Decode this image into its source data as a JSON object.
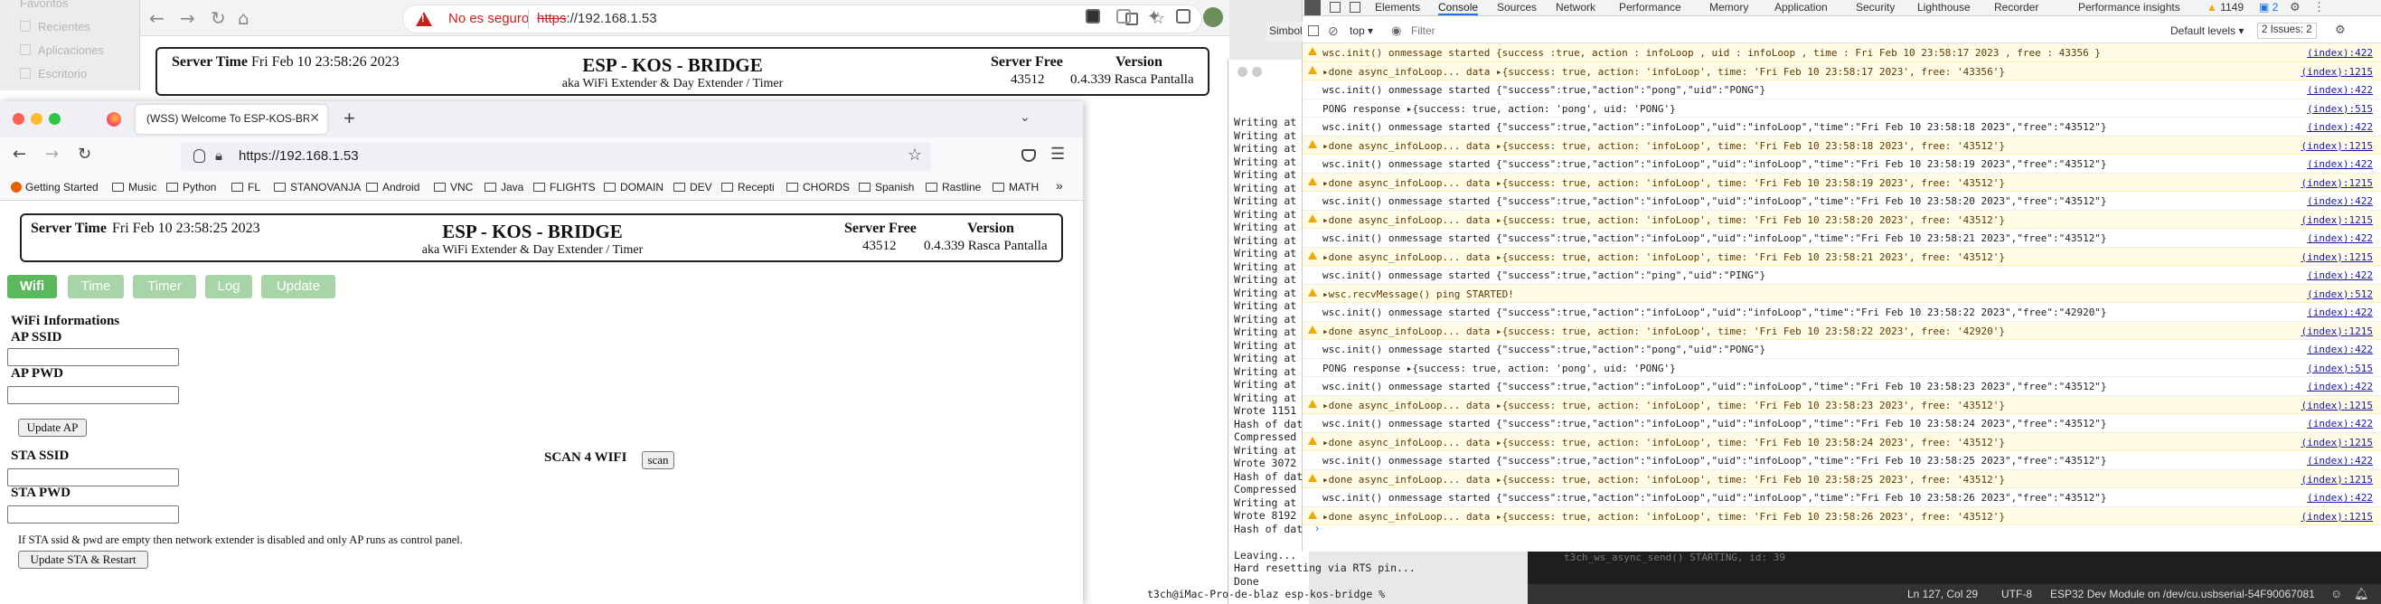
{
  "back_window": {
    "sidebar": [
      "Favoritos",
      "Recientes",
      "Aplicaciones",
      "Escritorio"
    ],
    "insecure_label": "No es seguro",
    "url_scheme": "https",
    "url_rest": "://192.168.1.53"
  },
  "esp_header": {
    "server_time_label": "Server Time",
    "title": "ESP - KOS - BRIDGE",
    "subtitle": "aka WiFi Extender & Day Extender / Timer",
    "server_free_label": "Server Free",
    "server_free_value": "43512",
    "version_label": "Version",
    "version_value": "0.4.339 Rasca Pantalla"
  },
  "back_window_time": "Fri Feb 10 23:58:26 2023",
  "firefox": {
    "tab_title": "(WSS) Welcome To ESP-KOS-BRIDG",
    "url": "https://192.168.1.53",
    "bookmarks": [
      "Getting Started",
      "Music",
      "Python",
      "FL",
      "STANOVANJA",
      "Android",
      "VNC",
      "Java",
      "FLIGHTS",
      "DOMAIN",
      "DEV",
      "Recepti",
      "CHORDS",
      "Spanish",
      "Rastline",
      "MATH"
    ],
    "server_time": "Fri Feb 10 23:58:25 2023",
    "nav_buttons": [
      "Wifi",
      "Time",
      "Timer",
      "Log",
      "Update"
    ],
    "wifi_info_heading": "WiFi Informations",
    "ap_ssid_label": "AP SSID",
    "ap_pwd_label": "AP PWD",
    "update_ap_button": "Update AP",
    "sta_ssid_label": "STA SSID",
    "scan_label": "SCAN 4 WIFI",
    "scan_button": "scan",
    "sta_pwd_label": "STA PWD",
    "note": "If STA ssid & pwd are empty then network extender is disabled and only AP runs as control panel.",
    "update_sta_button": "Update STA & Restart",
    "colors": {
      "active_tab": "#5cb85c",
      "inactive_tab": "#a8d5a8"
    }
  },
  "terminal": {
    "lines": [
      "Writing at",
      "Writing at",
      "Writing at",
      "Writing at",
      "Writing at",
      "Writing at",
      "Writing at",
      "Writing at",
      "Writing at",
      "Writing at",
      "Writing at",
      "Writing at",
      "Writing at",
      "Writing at",
      "Writing at",
      "Writing at",
      "Writing at",
      "Writing at",
      "Writing at",
      "Writing at",
      "Writing at",
      "Writing at",
      "Wrote 1151",
      "Hash of dat",
      "Compressed",
      "Writing at",
      "Wrote 3072",
      "Hash of dat",
      "Compressed",
      "Writing at",
      "Wrote 8192",
      "Hash of dat",
      "",
      "Leaving...",
      "Hard resetting via RTS pin...",
      "Done",
      "t3ch@iMac-Pro-de-blaz esp-kos-bridge % "
    ]
  },
  "devtools": {
    "tabs": [
      "Elements",
      "Console",
      "Sources",
      "Network",
      "Performance",
      "Memory",
      "Application",
      "Security",
      "Lighthouse",
      "Recorder",
      "Performance insights"
    ],
    "context": "top",
    "filter_placeholder": "Filter",
    "levels": "Default levels",
    "warn_count": "1149",
    "msg_count": "2",
    "issues": "2 Issues: 2",
    "side_label": "Simbol",
    "console": [
      {
        "t": "w",
        "m": "wsc.init() onmessage started {success :true, action : infoLoop , uid : infoLoop , time : Fri Feb 10 23:58:17 2023 , free : 43356 }",
        "s": "(index):422"
      },
      {
        "t": "w",
        "m": "▸done async_infoLoop... data ▸{success: true, action: 'infoLoop', time: 'Fri Feb 10 23:58:17 2023', free: '43356'}",
        "s": "(index):1215"
      },
      {
        "t": "n",
        "m": "wsc.init() onmessage started {\"success\":true,\"action\":\"pong\",\"uid\":\"PONG\"}",
        "s": "(index):422"
      },
      {
        "t": "n",
        "m": "PONG response ▸{success: true, action: 'pong', uid: 'PONG'}",
        "s": "(index):515"
      },
      {
        "t": "n",
        "m": "wsc.init() onmessage started {\"success\":true,\"action\":\"infoLoop\",\"uid\":\"infoLoop\",\"time\":\"Fri Feb 10 23:58:18 2023\",\"free\":\"43512\"}",
        "s": "(index):422"
      },
      {
        "t": "w",
        "m": "▸done async_infoLoop... data ▸{success: true, action: 'infoLoop', time: 'Fri Feb 10 23:58:18 2023', free: '43512'}",
        "s": "(index):1215"
      },
      {
        "t": "n",
        "m": "wsc.init() onmessage started {\"success\":true,\"action\":\"infoLoop\",\"uid\":\"infoLoop\",\"time\":\"Fri Feb 10 23:58:19 2023\",\"free\":\"43512\"}",
        "s": "(index):422"
      },
      {
        "t": "w",
        "m": "▸done async_infoLoop... data ▸{success: true, action: 'infoLoop', time: 'Fri Feb 10 23:58:19 2023', free: '43512'}",
        "s": "(index):1215"
      },
      {
        "t": "n",
        "m": "wsc.init() onmessage started {\"success\":true,\"action\":\"infoLoop\",\"uid\":\"infoLoop\",\"time\":\"Fri Feb 10 23:58:20 2023\",\"free\":\"43512\"}",
        "s": "(index):422"
      },
      {
        "t": "w",
        "m": "▸done async_infoLoop... data ▸{success: true, action: 'infoLoop', time: 'Fri Feb 10 23:58:20 2023', free: '43512'}",
        "s": "(index):1215"
      },
      {
        "t": "n",
        "m": "wsc.init() onmessage started {\"success\":true,\"action\":\"infoLoop\",\"uid\":\"infoLoop\",\"time\":\"Fri Feb 10 23:58:21 2023\",\"free\":\"43512\"}",
        "s": "(index):422"
      },
      {
        "t": "w",
        "m": "▸done async_infoLoop... data ▸{success: true, action: 'infoLoop', time: 'Fri Feb 10 23:58:21 2023', free: '43512'}",
        "s": "(index):1215"
      },
      {
        "t": "n",
        "m": "wsc.init() onmessage started {\"success\":true,\"action\":\"ping\",\"uid\":\"PING\"}",
        "s": "(index):422"
      },
      {
        "t": "w",
        "m": "▸wsc.recvMessage() ping STARTED!",
        "s": "(index):512"
      },
      {
        "t": "n",
        "m": "wsc.init() onmessage started {\"success\":true,\"action\":\"infoLoop\",\"uid\":\"infoLoop\",\"time\":\"Fri Feb 10 23:58:22 2023\",\"free\":\"42920\"}",
        "s": "(index):422"
      },
      {
        "t": "w",
        "m": "▸done async_infoLoop... data ▸{success: true, action: 'infoLoop', time: 'Fri Feb 10 23:58:22 2023', free: '42920'}",
        "s": "(index):1215"
      },
      {
        "t": "n",
        "m": "wsc.init() onmessage started {\"success\":true,\"action\":\"pong\",\"uid\":\"PONG\"}",
        "s": "(index):422"
      },
      {
        "t": "n",
        "m": "PONG response ▸{success: true, action: 'pong', uid: 'PONG'}",
        "s": "(index):515"
      },
      {
        "t": "n",
        "m": "wsc.init() onmessage started {\"success\":true,\"action\":\"infoLoop\",\"uid\":\"infoLoop\",\"time\":\"Fri Feb 10 23:58:23 2023\",\"free\":\"43512\"}",
        "s": "(index):422"
      },
      {
        "t": "w",
        "m": "▸done async_infoLoop... data ▸{success: true, action: 'infoLoop', time: 'Fri Feb 10 23:58:23 2023', free: '43512'}",
        "s": "(index):1215"
      },
      {
        "t": "n",
        "m": "wsc.init() onmessage started {\"success\":true,\"action\":\"infoLoop\",\"uid\":\"infoLoop\",\"time\":\"Fri Feb 10 23:58:24 2023\",\"free\":\"43512\"}",
        "s": "(index):422"
      },
      {
        "t": "w",
        "m": "▸done async_infoLoop... data ▸{success: true, action: 'infoLoop', time: 'Fri Feb 10 23:58:24 2023', free: '43512'}",
        "s": "(index):1215"
      },
      {
        "t": "n",
        "m": "wsc.init() onmessage started {\"success\":true,\"action\":\"infoLoop\",\"uid\":\"infoLoop\",\"time\":\"Fri Feb 10 23:58:25 2023\",\"free\":\"43512\"}",
        "s": "(index):422"
      },
      {
        "t": "w",
        "m": "▸done async_infoLoop... data ▸{success: true, action: 'infoLoop', time: 'Fri Feb 10 23:58:25 2023', free: '43512'}",
        "s": "(index):1215"
      },
      {
        "t": "n",
        "m": "wsc.init() onmessage started {\"success\":true,\"action\":\"infoLoop\",\"uid\":\"infoLoop\",\"time\":\"Fri Feb 10 23:58:26 2023\",\"free\":\"43512\"}",
        "s": "(index):422"
      },
      {
        "t": "w",
        "m": "▸done async_infoLoop... data ▸{success: true, action: 'infoLoop', time: 'Fri Feb 10 23:58:26 2023', free: '43512'}",
        "s": "(index):1215"
      }
    ]
  },
  "vscode": {
    "log_line": "t3ch_ws_async_send() STARTING, id: 39",
    "position": "Ln 127, Col 29",
    "encoding": "UTF-8",
    "board": "ESP32 Dev Module on /dev/cu.usbserial-54F90067081"
  }
}
